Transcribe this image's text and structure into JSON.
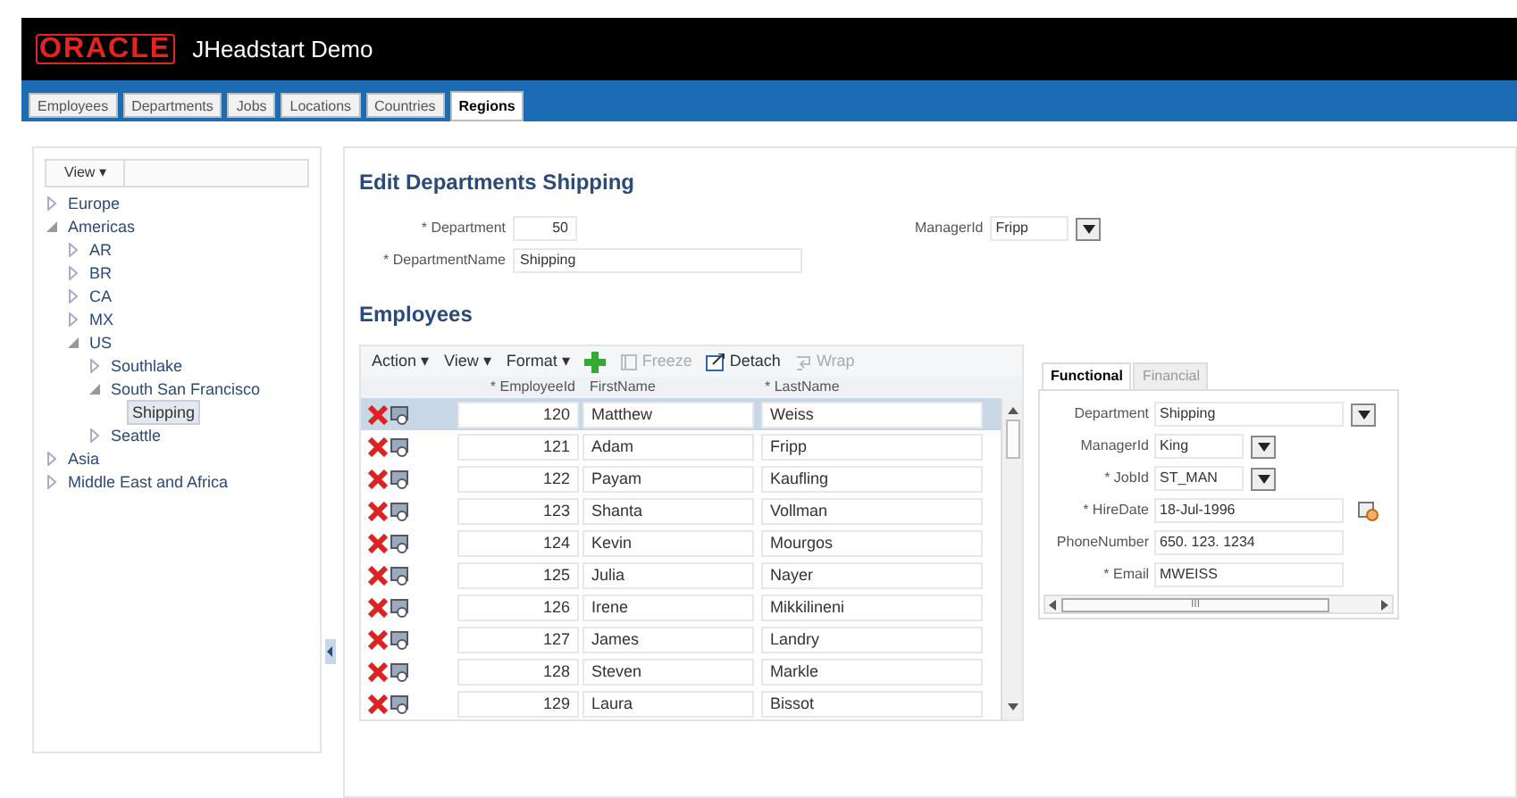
{
  "header": {
    "logo": "ORACLE",
    "title": "JHeadstart Demo"
  },
  "tabs": [
    {
      "label": "Employees",
      "selected": false
    },
    {
      "label": "Departments",
      "selected": false
    },
    {
      "label": "Jobs",
      "selected": false
    },
    {
      "label": "Locations",
      "selected": false
    },
    {
      "label": "Countries",
      "selected": false
    },
    {
      "label": "Regions",
      "selected": true
    }
  ],
  "tree": {
    "menu": "View ▾",
    "items": [
      {
        "label": "Europe",
        "expanded": false,
        "selected": false
      },
      {
        "label": "Americas",
        "expanded": true,
        "selected": false,
        "children": [
          {
            "label": "AR",
            "expanded": false,
            "selected": false
          },
          {
            "label": "BR",
            "expanded": false,
            "selected": false
          },
          {
            "label": "CA",
            "expanded": false,
            "selected": false
          },
          {
            "label": "MX",
            "expanded": false,
            "selected": false
          },
          {
            "label": "US",
            "expanded": true,
            "selected": false,
            "children": [
              {
                "label": "Southlake",
                "expanded": false,
                "selected": false
              },
              {
                "label": "South San Francisco",
                "expanded": true,
                "selected": false,
                "children": [
                  {
                    "label": "Shipping",
                    "kind": "leaf",
                    "selected": true
                  }
                ]
              },
              {
                "label": "Seattle",
                "expanded": false,
                "selected": false
              }
            ]
          }
        ]
      },
      {
        "label": "Asia",
        "expanded": false,
        "selected": false
      },
      {
        "label": "Middle East and Africa",
        "expanded": false,
        "selected": false
      }
    ]
  },
  "form": {
    "title": "Edit Departments Shipping",
    "department": {
      "label": "* Department",
      "value": "50"
    },
    "department_name": {
      "label": "* DepartmentName",
      "value": "Shipping"
    },
    "manager": {
      "label": "ManagerId",
      "value": "Fripp"
    }
  },
  "employees": {
    "title": "Employees",
    "toolbar": [
      {
        "label": "Action ▾",
        "kind": "menu",
        "disabled": false
      },
      {
        "label": "View ▾",
        "kind": "menu",
        "disabled": false
      },
      {
        "label": "Format ▾",
        "kind": "menu",
        "disabled": false
      },
      {
        "kind": "add",
        "disabled": false
      },
      {
        "label": "Freeze",
        "kind": "freeze",
        "disabled": true
      },
      {
        "label": "Detach",
        "kind": "detach",
        "disabled": false
      },
      {
        "label": "Wrap",
        "kind": "wrap",
        "disabled": true
      }
    ],
    "columns": [
      {
        "label": "* EmployeeId"
      },
      {
        "label": "FirstName"
      },
      {
        "label": "* LastName"
      }
    ],
    "rows": [
      {
        "id": "120",
        "first": "Matthew",
        "last": "Weiss",
        "selected": true
      },
      {
        "id": "121",
        "first": "Adam",
        "last": "Fripp",
        "selected": false
      },
      {
        "id": "122",
        "first": "Payam",
        "last": "Kaufling",
        "selected": false
      },
      {
        "id": "123",
        "first": "Shanta",
        "last": "Vollman",
        "selected": false
      },
      {
        "id": "124",
        "first": "Kevin",
        "last": "Mourgos",
        "selected": false
      },
      {
        "id": "125",
        "first": "Julia",
        "last": "Nayer",
        "selected": false
      },
      {
        "id": "126",
        "first": "Irene",
        "last": "Mikkilineni",
        "selected": false
      },
      {
        "id": "127",
        "first": "James",
        "last": "Landry",
        "selected": false
      },
      {
        "id": "128",
        "first": "Steven",
        "last": "Markle",
        "selected": false
      },
      {
        "id": "129",
        "first": "Laura",
        "last": "Bissot",
        "selected": false
      }
    ]
  },
  "detail": {
    "tabs": [
      {
        "label": "Functional",
        "selected": true
      },
      {
        "label": "Financial",
        "selected": false
      }
    ],
    "fields": [
      {
        "label": "Department",
        "value": "Shipping",
        "kind": "select",
        "wide": true
      },
      {
        "label": "ManagerId",
        "value": "King",
        "kind": "select",
        "wide": false
      },
      {
        "label": "* JobId",
        "value": "ST_MAN",
        "kind": "select",
        "wide": false
      },
      {
        "label": "* HireDate",
        "value": "18-Jul-1996",
        "kind": "date",
        "wide": true
      },
      {
        "label": "PhoneNumber",
        "value": "650. 123. 1234",
        "kind": "text",
        "wide": true
      },
      {
        "label": "* Email",
        "value": "MWEISS",
        "kind": "text",
        "wide": true
      }
    ],
    "scroll_grip": "III"
  }
}
